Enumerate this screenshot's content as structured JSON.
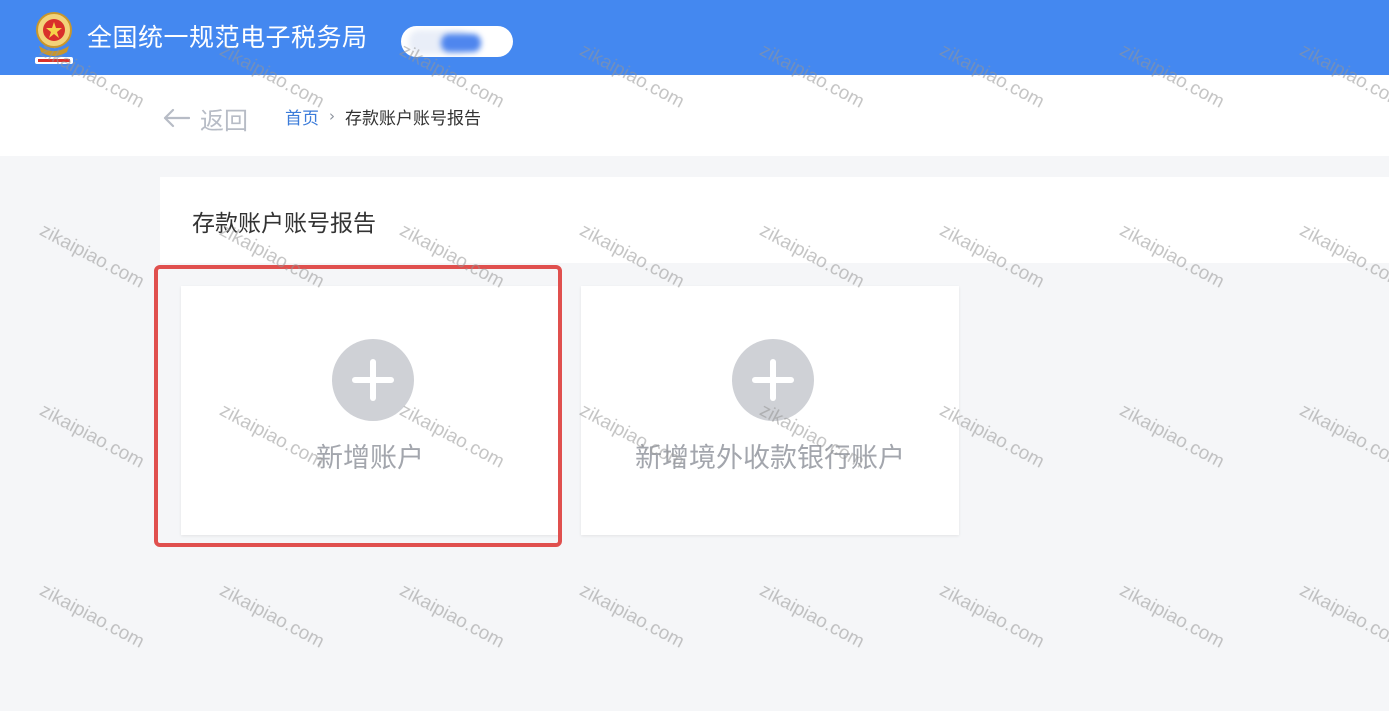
{
  "header": {
    "app_title": "全国统一规范电子税务局",
    "brand_color": "#4488f0"
  },
  "nav": {
    "back_label": "返回",
    "breadcrumb": {
      "home": "首页",
      "separator": "›",
      "current": "存款账户账号报告"
    }
  },
  "main": {
    "section_title": "存款账户账号报告",
    "tiles": [
      {
        "label": "新增账户",
        "icon": "plus-circle-icon",
        "highlighted": true
      },
      {
        "label": "新增境外收款银行账户",
        "icon": "plus-circle-icon",
        "highlighted": false
      }
    ],
    "highlight_color": "#e0504e"
  },
  "watermark": {
    "text": "zikaipiao.com"
  }
}
